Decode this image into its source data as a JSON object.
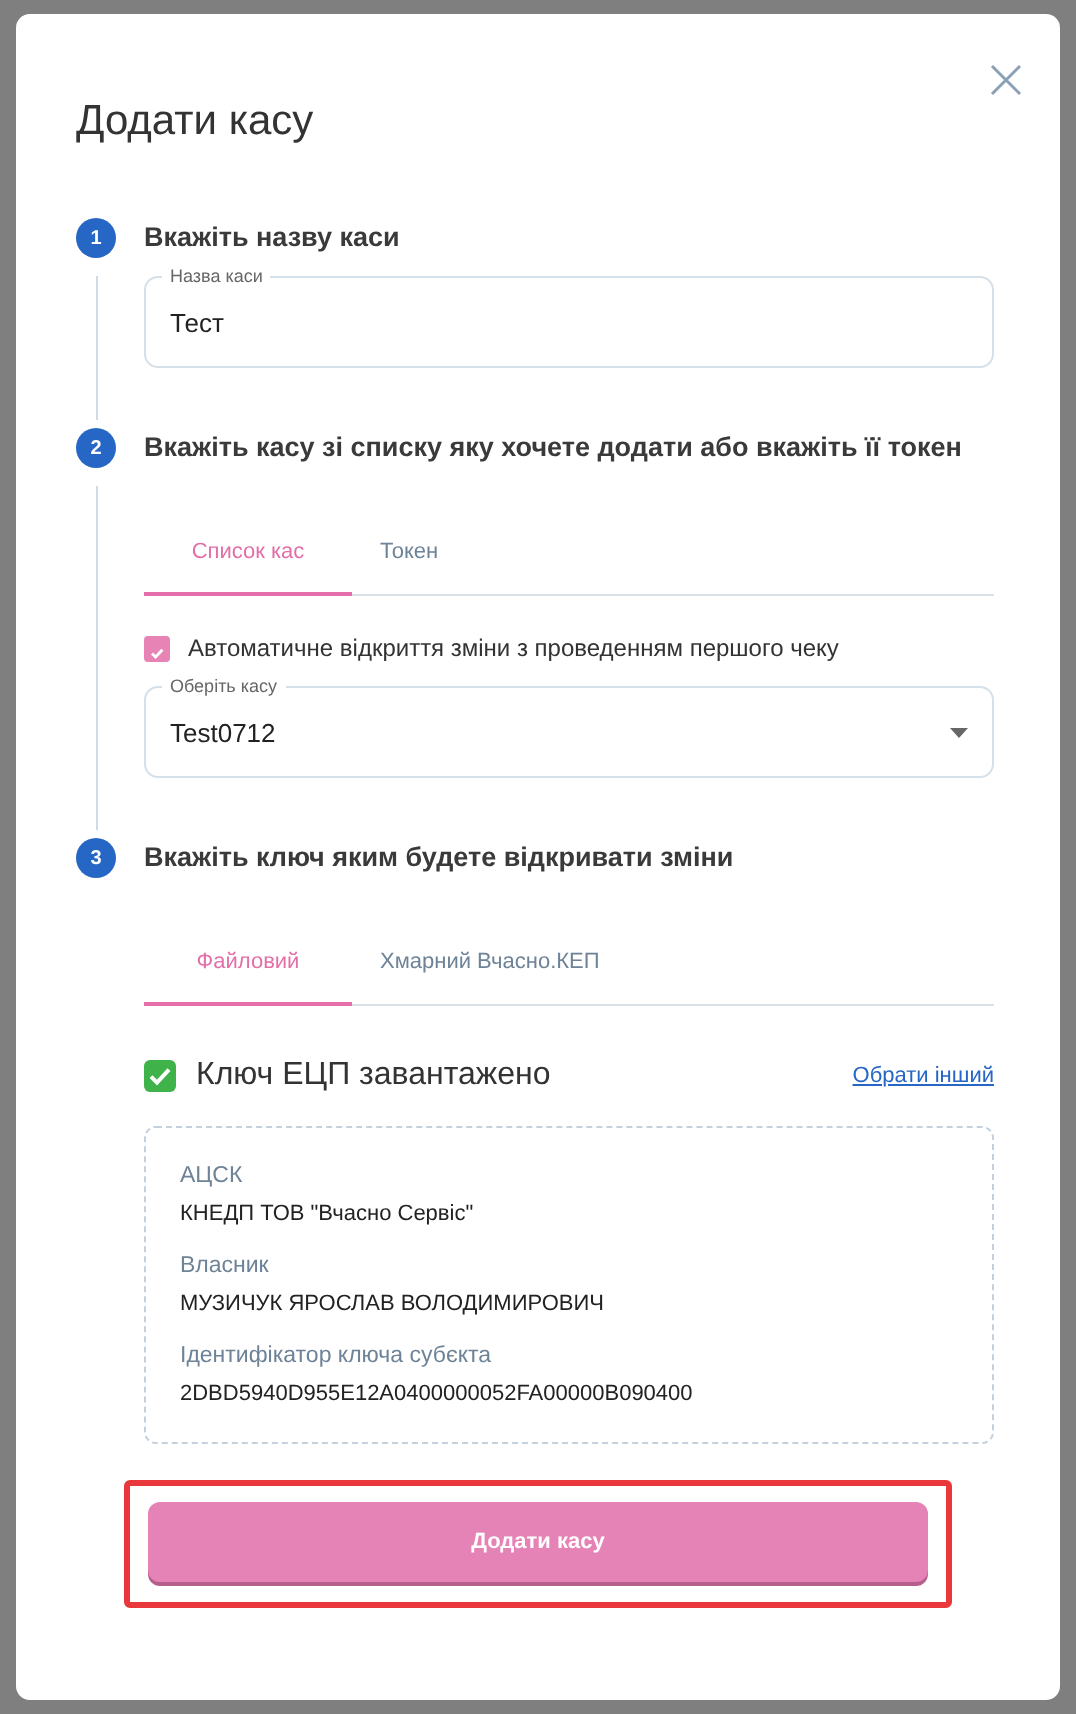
{
  "dialog": {
    "title": "Додати касу"
  },
  "steps": [
    {
      "number": "1",
      "label": "Вкажіть назву каси",
      "kind": "name",
      "field": {
        "label": "Назва каси",
        "value": "Тест"
      }
    },
    {
      "number": "2",
      "label": "Вкажіть касу зі списку яку хочете додати або вкажіть її токен",
      "kind": "register",
      "tabs": [
        {
          "label": "Список кас",
          "selected": true
        },
        {
          "label": "Токен",
          "selected": false
        }
      ],
      "checkbox": {
        "label": "Автоматичне відкриття зміни з проведенням першого чеку",
        "checked": true
      },
      "select": {
        "label": "Оберіть касу",
        "value": "Test0712"
      }
    },
    {
      "number": "3",
      "label": "Вкажіть ключ яким будете відкривати зміни",
      "kind": "key",
      "tabs": [
        {
          "label": "Файловий",
          "selected": true
        },
        {
          "label": "Хмарний Вчасно.КЕП",
          "selected": false
        }
      ],
      "status": {
        "text": "Ключ ЕЦП завантажено",
        "link": "Обрати інший"
      },
      "details": [
        {
          "label": "АЦСК",
          "value": "КНЕДП ТОВ \"Вчасно Сервіс\""
        },
        {
          "label": "Власник",
          "value": "МУЗИЧУК ЯРОСЛАВ ВОЛОДИМИРОВИЧ"
        },
        {
          "label": "Ідентифікатор ключа субєкта",
          "value": "2DBD5940D955E12A0400000052FA00000B090400"
        }
      ]
    }
  ],
  "submit": {
    "label": "Додати касу",
    "highlighted": true
  }
}
